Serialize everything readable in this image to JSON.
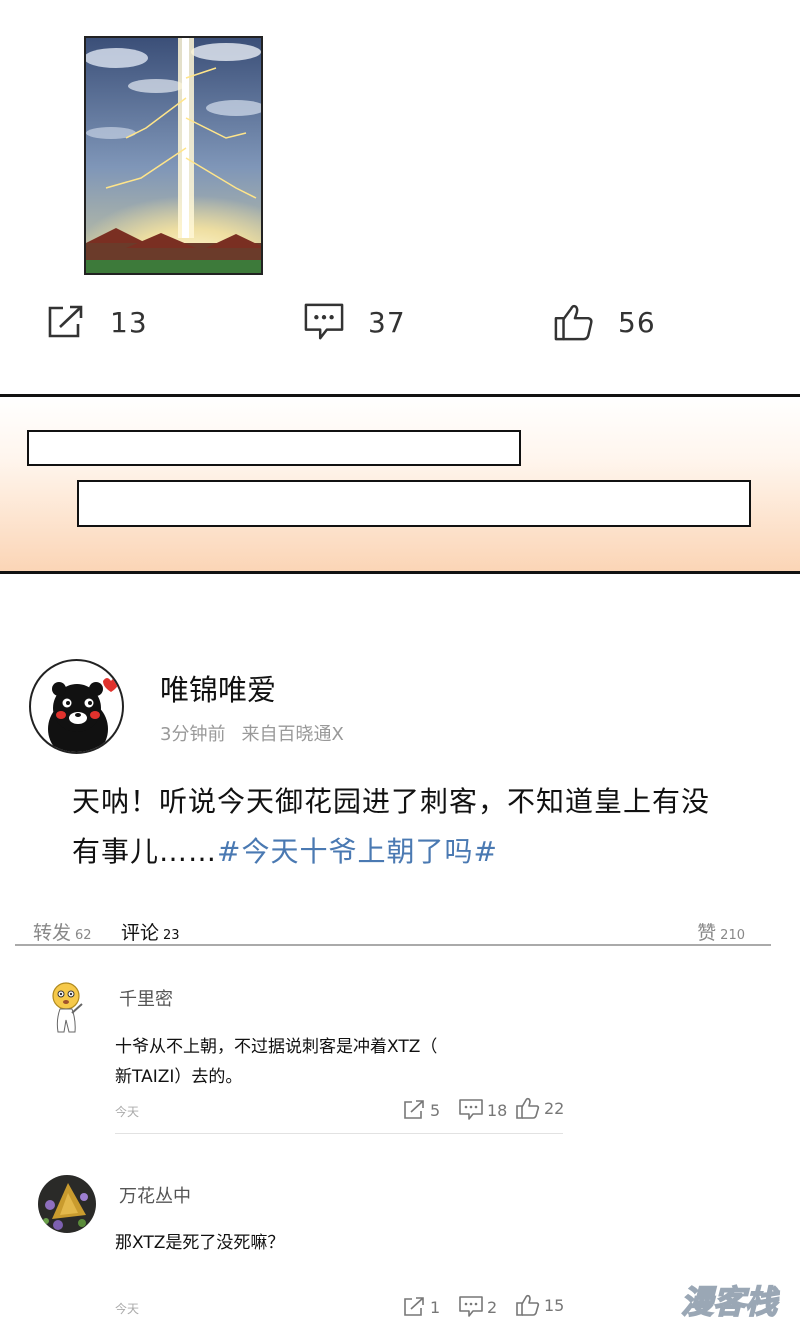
{
  "post": {
    "share_count": "13",
    "comment_count": "37",
    "like_count": "56"
  },
  "weibo": {
    "username": "唯锦唯爱",
    "time": "3分钟前",
    "source": "来自百晓通X",
    "text": "天呐！听说今天御花园进了刺客，不知道皇上有没有事儿……",
    "hashtag": "#今天十爷上朝了吗#",
    "tabs": {
      "repost_label": "转发",
      "repost_count": "62",
      "comment_label": "评论",
      "comment_count": "23",
      "like_label": "赞",
      "like_count": "210"
    }
  },
  "comments": [
    {
      "name": "千里密",
      "text_line1": "十爷从不上朝，不过据说刺客是冲着XTZ（",
      "text_line2": "新TAIZI）去的。",
      "time": "今天",
      "share": "5",
      "reply": "18",
      "like": "22"
    },
    {
      "name": "万花丛中",
      "text_line1": "那XTZ是死了没死嘛？",
      "time": "今天",
      "share": "1",
      "reply": "2",
      "like": "15"
    }
  ],
  "watermark": "漫客栈",
  "icons": {
    "share": "share-icon",
    "comment": "comment-icon",
    "like": "thumbs-up-icon"
  },
  "colors": {
    "hashtag": "#4a79b2",
    "band_bottom": "#fbd5b6"
  }
}
